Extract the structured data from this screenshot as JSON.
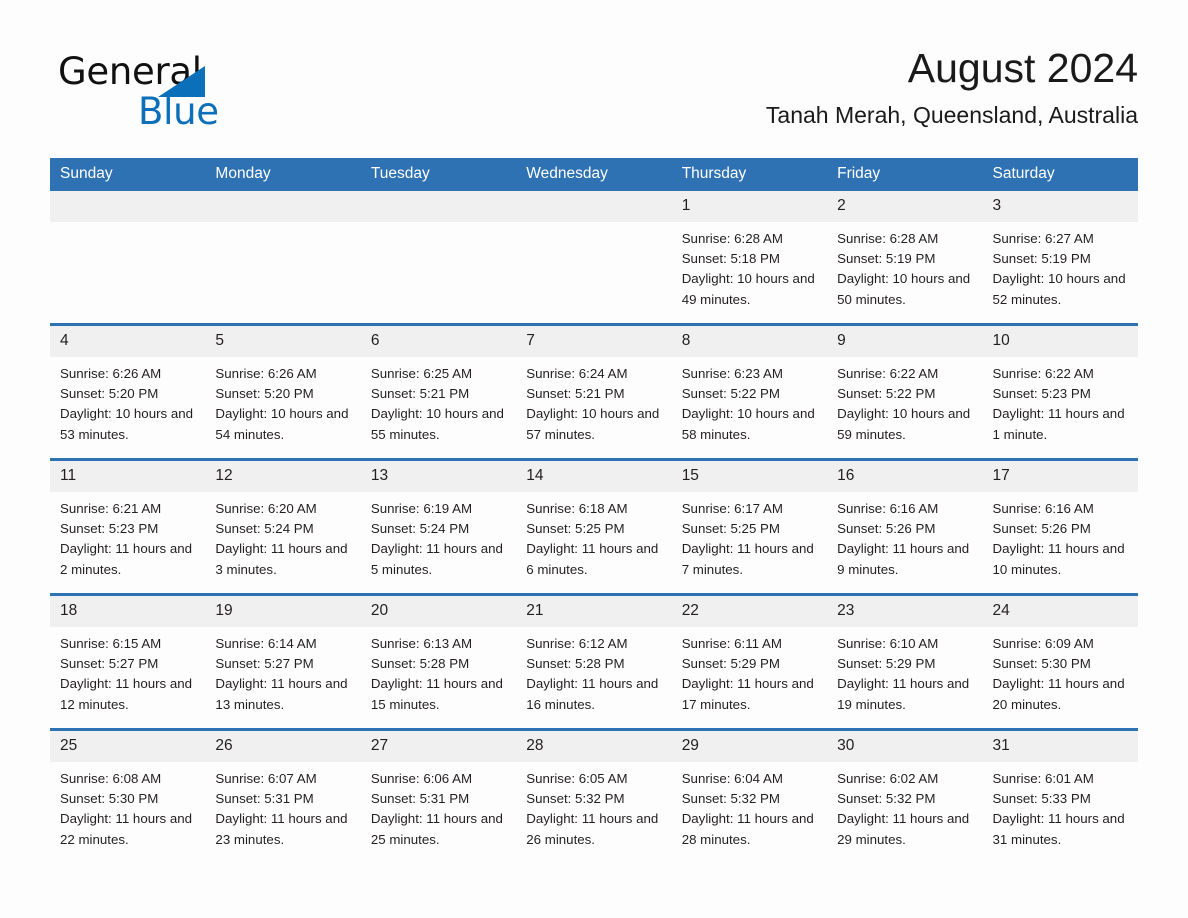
{
  "brand": {
    "name_part1": "General",
    "name_part2": "Blue",
    "triangle_color": "#0b6fba",
    "text_color": "#111111"
  },
  "header": {
    "title": "August 2024",
    "location": "Tanah Merah, Queensland, Australia",
    "accent_color": "#2e72b4",
    "daynum_bg": "#f0f0f0"
  },
  "weekday_headers": [
    "Sunday",
    "Monday",
    "Tuesday",
    "Wednesday",
    "Thursday",
    "Friday",
    "Saturday"
  ],
  "weeks": [
    [
      {
        "day": "",
        "sunrise": "",
        "sunset": "",
        "daylight": ""
      },
      {
        "day": "",
        "sunrise": "",
        "sunset": "",
        "daylight": ""
      },
      {
        "day": "",
        "sunrise": "",
        "sunset": "",
        "daylight": ""
      },
      {
        "day": "",
        "sunrise": "",
        "sunset": "",
        "daylight": ""
      },
      {
        "day": "1",
        "sunrise": "Sunrise: 6:28 AM",
        "sunset": "Sunset: 5:18 PM",
        "daylight": "Daylight: 10 hours and 49 minutes."
      },
      {
        "day": "2",
        "sunrise": "Sunrise: 6:28 AM",
        "sunset": "Sunset: 5:19 PM",
        "daylight": "Daylight: 10 hours and 50 minutes."
      },
      {
        "day": "3",
        "sunrise": "Sunrise: 6:27 AM",
        "sunset": "Sunset: 5:19 PM",
        "daylight": "Daylight: 10 hours and 52 minutes."
      }
    ],
    [
      {
        "day": "4",
        "sunrise": "Sunrise: 6:26 AM",
        "sunset": "Sunset: 5:20 PM",
        "daylight": "Daylight: 10 hours and 53 minutes."
      },
      {
        "day": "5",
        "sunrise": "Sunrise: 6:26 AM",
        "sunset": "Sunset: 5:20 PM",
        "daylight": "Daylight: 10 hours and 54 minutes."
      },
      {
        "day": "6",
        "sunrise": "Sunrise: 6:25 AM",
        "sunset": "Sunset: 5:21 PM",
        "daylight": "Daylight: 10 hours and 55 minutes."
      },
      {
        "day": "7",
        "sunrise": "Sunrise: 6:24 AM",
        "sunset": "Sunset: 5:21 PM",
        "daylight": "Daylight: 10 hours and 57 minutes."
      },
      {
        "day": "8",
        "sunrise": "Sunrise: 6:23 AM",
        "sunset": "Sunset: 5:22 PM",
        "daylight": "Daylight: 10 hours and 58 minutes."
      },
      {
        "day": "9",
        "sunrise": "Sunrise: 6:22 AM",
        "sunset": "Sunset: 5:22 PM",
        "daylight": "Daylight: 10 hours and 59 minutes."
      },
      {
        "day": "10",
        "sunrise": "Sunrise: 6:22 AM",
        "sunset": "Sunset: 5:23 PM",
        "daylight": "Daylight: 11 hours and 1 minute."
      }
    ],
    [
      {
        "day": "11",
        "sunrise": "Sunrise: 6:21 AM",
        "sunset": "Sunset: 5:23 PM",
        "daylight": "Daylight: 11 hours and 2 minutes."
      },
      {
        "day": "12",
        "sunrise": "Sunrise: 6:20 AM",
        "sunset": "Sunset: 5:24 PM",
        "daylight": "Daylight: 11 hours and 3 minutes."
      },
      {
        "day": "13",
        "sunrise": "Sunrise: 6:19 AM",
        "sunset": "Sunset: 5:24 PM",
        "daylight": "Daylight: 11 hours and 5 minutes."
      },
      {
        "day": "14",
        "sunrise": "Sunrise: 6:18 AM",
        "sunset": "Sunset: 5:25 PM",
        "daylight": "Daylight: 11 hours and 6 minutes."
      },
      {
        "day": "15",
        "sunrise": "Sunrise: 6:17 AM",
        "sunset": "Sunset: 5:25 PM",
        "daylight": "Daylight: 11 hours and 7 minutes."
      },
      {
        "day": "16",
        "sunrise": "Sunrise: 6:16 AM",
        "sunset": "Sunset: 5:26 PM",
        "daylight": "Daylight: 11 hours and 9 minutes."
      },
      {
        "day": "17",
        "sunrise": "Sunrise: 6:16 AM",
        "sunset": "Sunset: 5:26 PM",
        "daylight": "Daylight: 11 hours and 10 minutes."
      }
    ],
    [
      {
        "day": "18",
        "sunrise": "Sunrise: 6:15 AM",
        "sunset": "Sunset: 5:27 PM",
        "daylight": "Daylight: 11 hours and 12 minutes."
      },
      {
        "day": "19",
        "sunrise": "Sunrise: 6:14 AM",
        "sunset": "Sunset: 5:27 PM",
        "daylight": "Daylight: 11 hours and 13 minutes."
      },
      {
        "day": "20",
        "sunrise": "Sunrise: 6:13 AM",
        "sunset": "Sunset: 5:28 PM",
        "daylight": "Daylight: 11 hours and 15 minutes."
      },
      {
        "day": "21",
        "sunrise": "Sunrise: 6:12 AM",
        "sunset": "Sunset: 5:28 PM",
        "daylight": "Daylight: 11 hours and 16 minutes."
      },
      {
        "day": "22",
        "sunrise": "Sunrise: 6:11 AM",
        "sunset": "Sunset: 5:29 PM",
        "daylight": "Daylight: 11 hours and 17 minutes."
      },
      {
        "day": "23",
        "sunrise": "Sunrise: 6:10 AM",
        "sunset": "Sunset: 5:29 PM",
        "daylight": "Daylight: 11 hours and 19 minutes."
      },
      {
        "day": "24",
        "sunrise": "Sunrise: 6:09 AM",
        "sunset": "Sunset: 5:30 PM",
        "daylight": "Daylight: 11 hours and 20 minutes."
      }
    ],
    [
      {
        "day": "25",
        "sunrise": "Sunrise: 6:08 AM",
        "sunset": "Sunset: 5:30 PM",
        "daylight": "Daylight: 11 hours and 22 minutes."
      },
      {
        "day": "26",
        "sunrise": "Sunrise: 6:07 AM",
        "sunset": "Sunset: 5:31 PM",
        "daylight": "Daylight: 11 hours and 23 minutes."
      },
      {
        "day": "27",
        "sunrise": "Sunrise: 6:06 AM",
        "sunset": "Sunset: 5:31 PM",
        "daylight": "Daylight: 11 hours and 25 minutes."
      },
      {
        "day": "28",
        "sunrise": "Sunrise: 6:05 AM",
        "sunset": "Sunset: 5:32 PM",
        "daylight": "Daylight: 11 hours and 26 minutes."
      },
      {
        "day": "29",
        "sunrise": "Sunrise: 6:04 AM",
        "sunset": "Sunset: 5:32 PM",
        "daylight": "Daylight: 11 hours and 28 minutes."
      },
      {
        "day": "30",
        "sunrise": "Sunrise: 6:02 AM",
        "sunset": "Sunset: 5:32 PM",
        "daylight": "Daylight: 11 hours and 29 minutes."
      },
      {
        "day": "31",
        "sunrise": "Sunrise: 6:01 AM",
        "sunset": "Sunset: 5:33 PM",
        "daylight": "Daylight: 11 hours and 31 minutes."
      }
    ]
  ]
}
